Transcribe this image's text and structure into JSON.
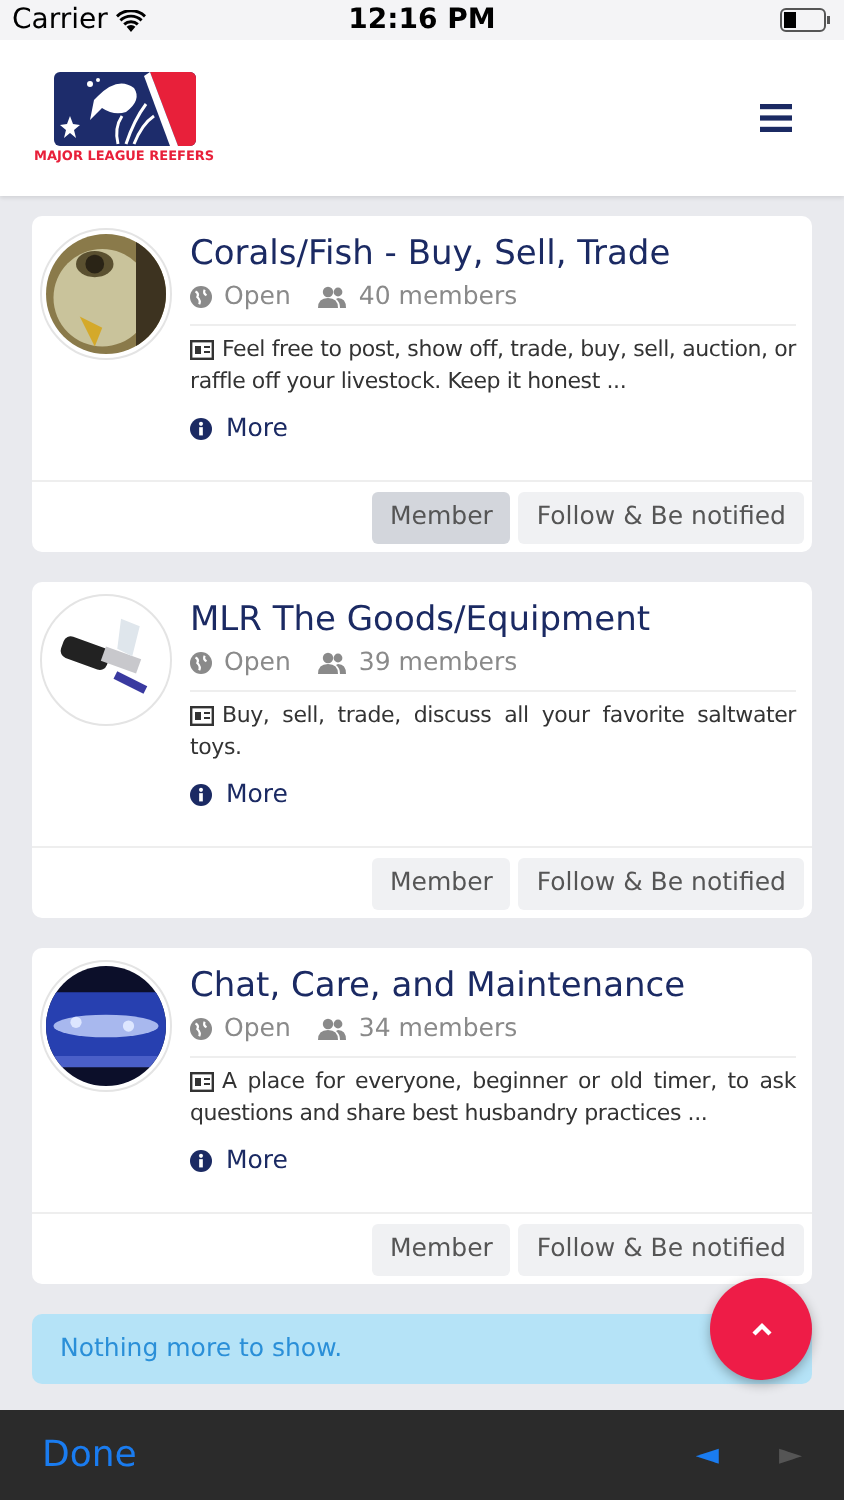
{
  "status_bar": {
    "carrier": "Carrier",
    "time": "12:16 PM"
  },
  "header": {
    "logo_text": "MAJOR LEAGUE REEFERS"
  },
  "groups": [
    {
      "title": "Corals/Fish - Buy, Sell, Trade",
      "privacy": "Open",
      "members": "40 members",
      "description": "Feel free to post, show off, trade, buy, sell, auction, or raffle off your livestock. Keep it honest ...",
      "more": "More",
      "member_button": {
        "label": "Member",
        "selected": true
      },
      "follow_button": "Follow & Be notified"
    },
    {
      "title": "MLR The Goods/Equipment",
      "privacy": "Open",
      "members": "39 members",
      "description": "Buy, sell, trade, discuss all your favorite saltwater toys.",
      "more": "More",
      "member_button": {
        "label": "Member",
        "selected": false
      },
      "follow_button": "Follow & Be notified"
    },
    {
      "title": "Chat, Care, and Maintenance",
      "privacy": "Open",
      "members": "34 members",
      "description": "A place for everyone, beginner or old timer, to ask questions and share best husbandry practices ...",
      "more": "More",
      "member_button": {
        "label": "Member",
        "selected": false
      },
      "follow_button": "Follow & Be notified"
    }
  ],
  "notice": "Nothing more to show.",
  "toolbar": {
    "done": "Done",
    "back": {
      "label": "◄",
      "disabled": false
    },
    "forward": {
      "label": "►",
      "disabled": true
    }
  }
}
